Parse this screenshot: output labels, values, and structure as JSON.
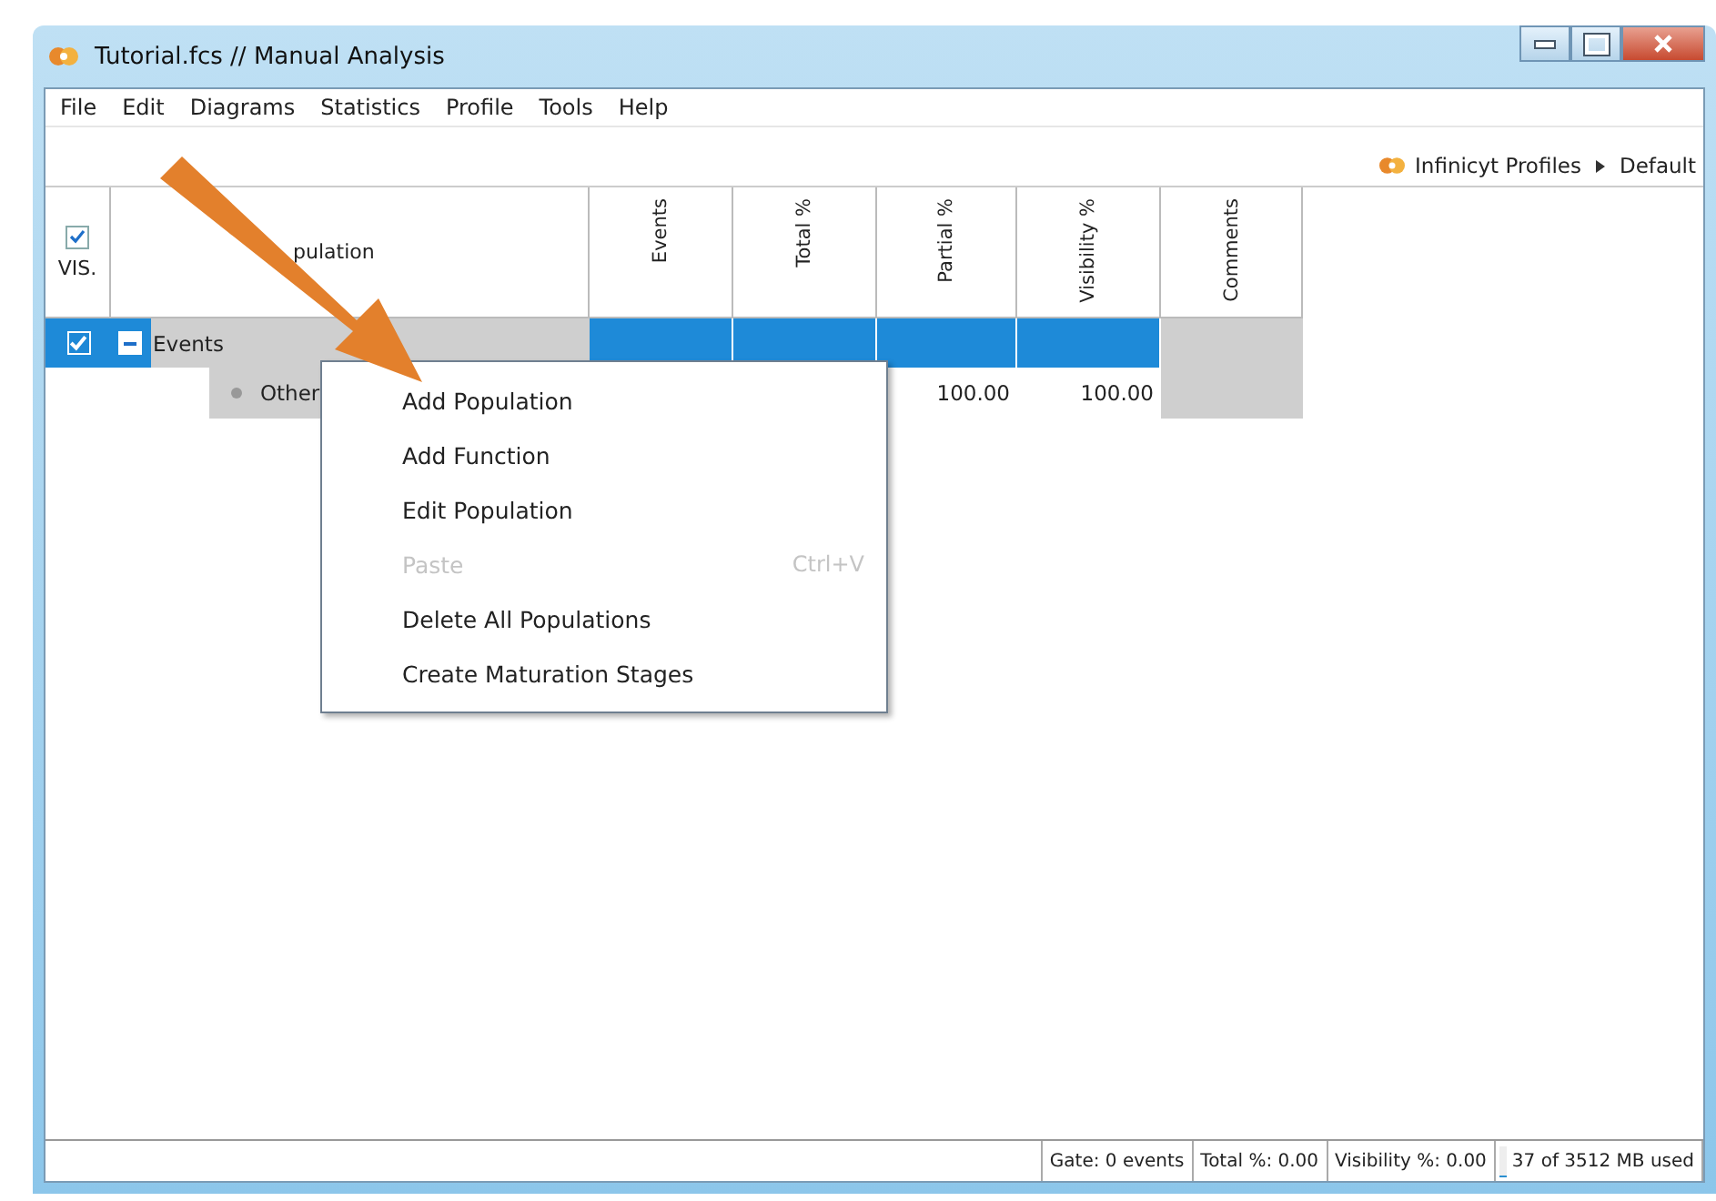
{
  "window": {
    "title": "Tutorial.fcs // Manual Analysis"
  },
  "menu_bar": [
    "File",
    "Edit",
    "Diagrams",
    "Statistics",
    "Profile",
    "Tools",
    "Help"
  ],
  "breadcrumb": [
    "Infinicyt Profiles",
    "Default"
  ],
  "table": {
    "vis_header": "VIS.",
    "vis_all_checked": true,
    "columns": [
      "pulation",
      "Events",
      "Total %",
      "Partial %",
      "Visibility %",
      "Comments"
    ],
    "rows": [
      {
        "label": "Events",
        "checked": true,
        "expanded": true,
        "selected": true,
        "children": [
          {
            "label": "Other",
            "partial": "100.00",
            "visibility": "100.00"
          }
        ]
      }
    ]
  },
  "context_menu": [
    {
      "label": "Add Population",
      "disabled": false
    },
    {
      "label": "Add Function",
      "disabled": false
    },
    {
      "label": "Edit Population",
      "disabled": false
    },
    {
      "label": "Paste",
      "shortcut": "Ctrl+V",
      "disabled": true
    },
    {
      "label": "Delete All Populations",
      "disabled": false
    },
    {
      "label": "Create Maturation Stages",
      "disabled": false
    }
  ],
  "status_bar": {
    "gate": "Gate: 0 events",
    "total": "Total %: 0.00",
    "visibility": "Visibility %: 0.00",
    "memory": {
      "text": "37 of 3512 MB used",
      "level": 0.03
    }
  }
}
